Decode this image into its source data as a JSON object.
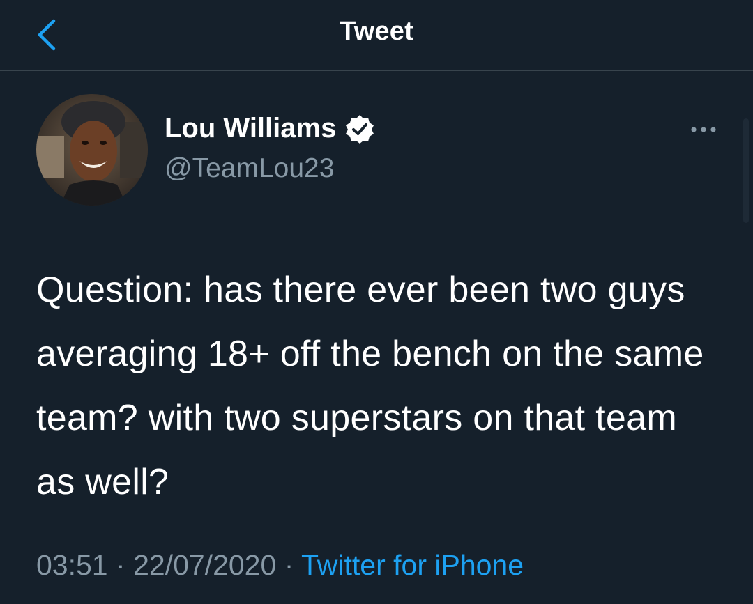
{
  "header": {
    "title": "Tweet",
    "back_icon": "chevron-left-icon",
    "accent_color": "#1da1f2"
  },
  "author": {
    "name": "Lou Williams",
    "handle": "@TeamLou23",
    "verified": true,
    "verified_icon": "verified-badge-icon",
    "avatar_icon": "avatar-photo"
  },
  "more_icon": "ellipsis-icon",
  "tweet": {
    "text": "Question: has there ever been two guys averaging 18+ off the bench on the same team? with two superstars on that team as well?"
  },
  "meta": {
    "time": "03:51",
    "separator": "·",
    "date": "22/07/2020",
    "source": "Twitter for iPhone"
  },
  "colors": {
    "background": "#15202b",
    "secondary_text": "#8899a6",
    "divider": "#38444d"
  }
}
